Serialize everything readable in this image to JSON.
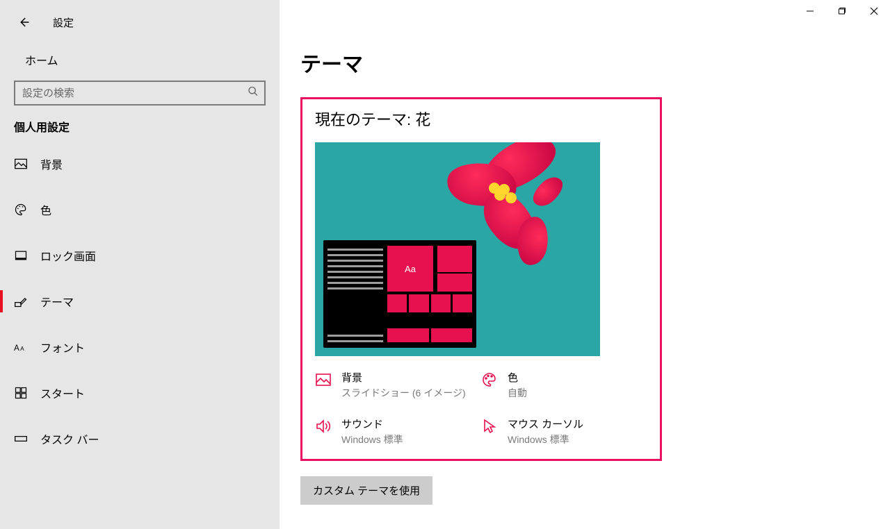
{
  "app_title": "設定",
  "home_label": "ホーム",
  "search_placeholder": "設定の検索",
  "section_label": "個人用設定",
  "nav": {
    "background": "背景",
    "colors": "色",
    "lockscreen": "ロック画面",
    "themes": "テーマ",
    "fonts": "フォント",
    "start": "スタート",
    "taskbar": "タスク バー"
  },
  "page_title": "テーマ",
  "current_theme_label": "現在のテーマ: 花",
  "preview_tile_text": "Aa",
  "options": {
    "background": {
      "title": "背景",
      "sub": "スライドショー (6 イメージ)"
    },
    "color": {
      "title": "色",
      "sub": "自動"
    },
    "sound": {
      "title": "サウンド",
      "sub": "Windows 標準"
    },
    "cursor": {
      "title": "マウス カーソル",
      "sub": "Windows 標準"
    }
  },
  "custom_theme_button": "カスタム テーマを使用"
}
